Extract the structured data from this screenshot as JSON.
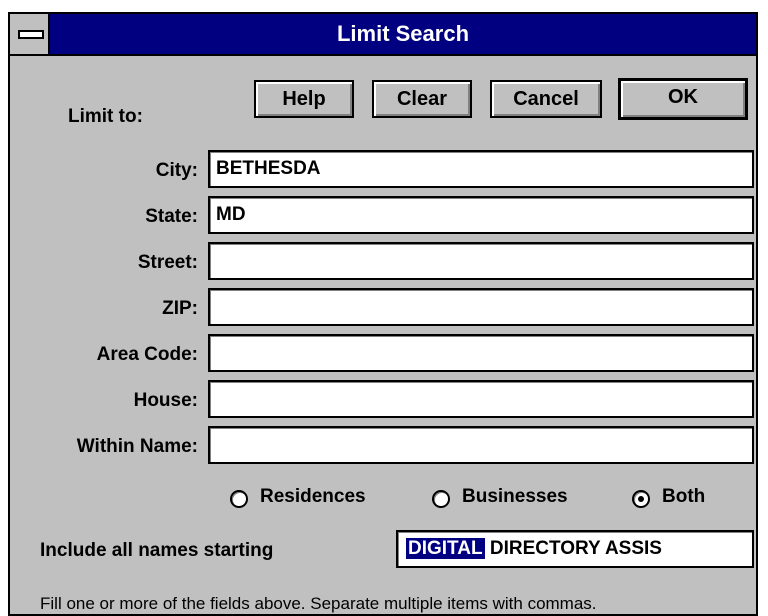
{
  "window": {
    "title": "Limit Search"
  },
  "buttons": {
    "help": "Help",
    "clear": "Clear",
    "cancel": "Cancel",
    "ok": "OK"
  },
  "limit_label": "Limit to:",
  "fields": [
    {
      "label": "City:",
      "value": "BETHESDA"
    },
    {
      "label": "State:",
      "value": "MD"
    },
    {
      "label": "Street:",
      "value": ""
    },
    {
      "label": "ZIP:",
      "value": ""
    },
    {
      "label": "Area Code:",
      "value": ""
    },
    {
      "label": "House:",
      "value": ""
    },
    {
      "label": "Within Name:",
      "value": ""
    }
  ],
  "radio": {
    "options": [
      "Residences",
      "Businesses",
      "Both"
    ],
    "selected": "Both"
  },
  "include": {
    "label": "Include all names starting",
    "selected_text": "DIGITAL",
    "rest_text": " DIRECTORY ASSIS"
  },
  "hint": "Fill one or more of the fields above. Separate multiple items with commas."
}
